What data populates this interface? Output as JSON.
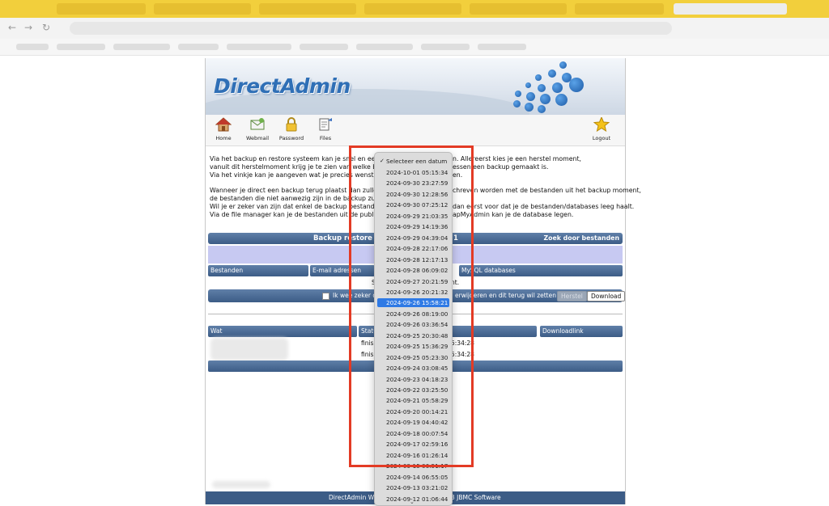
{
  "page": {
    "logo": "DirectAdmin",
    "nav": [
      {
        "label": "Home",
        "icon": "house-icon"
      },
      {
        "label": "Webmail",
        "icon": "mail-icon"
      },
      {
        "label": "Password",
        "icon": "lock-icon"
      },
      {
        "label": "Files",
        "icon": "files-icon"
      }
    ],
    "logout": {
      "label": "Logout",
      "icon": "star-icon"
    },
    "intro": [
      "Via het backup en restore systeem kan je snel en eenvoud",
      "vanuit dit herstelmoment krijg je te zien van welke bestan",
      "Via het vinkje kan je aangeven wat je precies wenst terug",
      "",
      "Wanneer je direct een backup terug plaatst dan zullen de b",
      "de bestanden die niet aanwezig zijn in de backup zullen bl",
      "Wil je er zeker van zijn dat enkel de backup bestanden ter",
      "Via de file manager kan je de bestanden uit de public_htm"
    ],
    "intro_right": [
      "n. Allereerst kies je een herstel moment,",
      "essen een backup gemaakt is.",
      "en.",
      "",
      "chreven worden met de bestanden uit het backup moment,",
      "",
      "dan eerst voor dat je de bestanden/databases leeg haalt.",
      "apMyAdmin kan je de database legen."
    ],
    "backup_header": "Backup restore v",
    "backup_header_tail": "1",
    "search_files": "Zoek door bestanden",
    "tabs": [
      "Bestanden",
      "E-mail adressen",
      "MySQL databases"
    ],
    "note_left": "S",
    "note_right": "nt.",
    "confirm_left": "Ik wee zeker d",
    "confirm_right": "erwijderen en dit terug wil zetten",
    "restore_btn": "Herstel",
    "download_btn": "Download",
    "table_headers": [
      "Wat",
      "Statu",
      "Downloadlink"
    ],
    "rows": [
      {
        "status": "finish",
        "time": "5:34:28"
      },
      {
        "status": "finish",
        "time": "5:34:28"
      }
    ],
    "footer_left": "DirectAdmin We",
    "footer_right": "3 JBMC Software"
  },
  "dropdown": {
    "placeholder": "Selecteer een datum",
    "selected_index": 13,
    "options": [
      "2024-10-01 05:15:34",
      "2024-09-30 23:27:59",
      "2024-09-30 12:28:56",
      "2024-09-30 07:25:12",
      "2024-09-29 21:03:35",
      "2024-09-29 14:19:36",
      "2024-09-29 04:39:04",
      "2024-09-28 22:17:06",
      "2024-09-28 12:17:13",
      "2024-09-28 06:09:02",
      "2024-09-27 20:21:59",
      "2024-09-26 20:21:32",
      "2024-09-26 15:58:21",
      "2024-09-26 08:19:00",
      "2024-09-26 03:36:54",
      "2024-09-25 20:30:48",
      "2024-09-25 15:36:29",
      "2024-09-25 05:23:30",
      "2024-09-24 03:08:45",
      "2024-09-23 04:18:23",
      "2024-09-22 03:25:50",
      "2024-09-21 05:58:29",
      "2024-09-20 00:14:21",
      "2024-09-19 04:40:42",
      "2024-09-18 00:07:54",
      "2024-09-17 02:59:16",
      "2024-09-16 01:26:14",
      "2024-09-15 06:51:17",
      "2024-09-14 06:55:05",
      "2024-09-13 03:21:02",
      "2024-09-12 01:06:44"
    ]
  },
  "colors": {
    "accent": "#2f7ae5",
    "header_blue": "#3c5c86",
    "annotation_red": "#e33b25",
    "chrome_yellow": "#f2cf3c"
  }
}
